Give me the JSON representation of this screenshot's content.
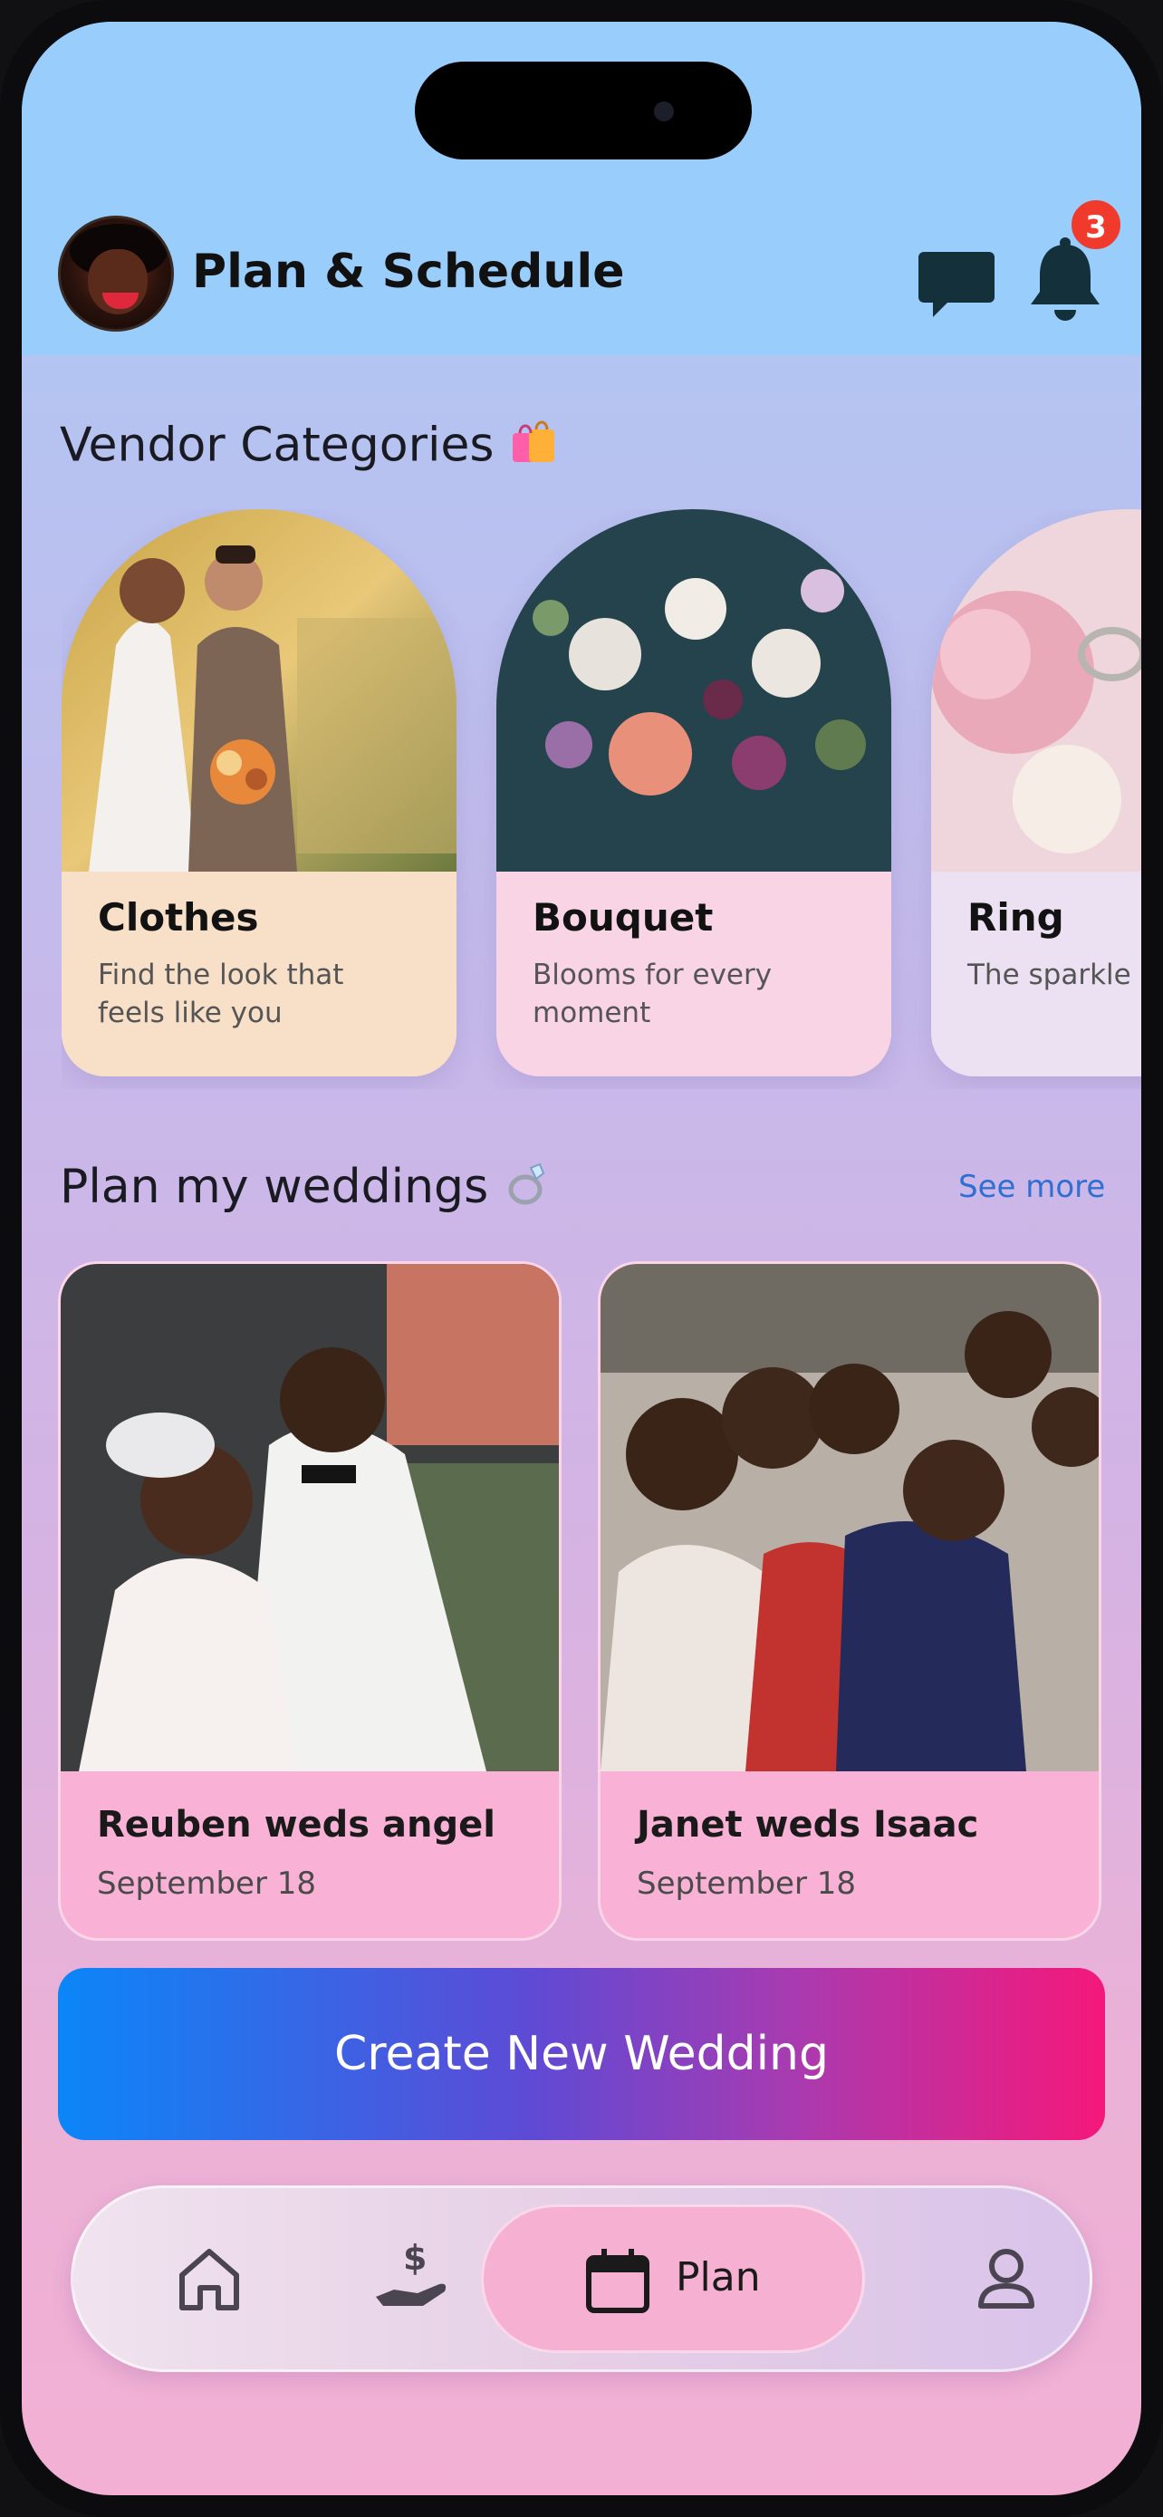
{
  "header": {
    "title": "Plan & Schedule",
    "notification_count": "3"
  },
  "vendor_section": {
    "title": "Vendor Categories",
    "emoji": "🛍️"
  },
  "vendors": [
    {
      "title": "Clothes",
      "subtitle": "Find the look that feels like you",
      "color": "#f7dfc8"
    },
    {
      "title": "Bouquet",
      "subtitle": "Blooms for every moment",
      "color": "#f8d4e4"
    },
    {
      "title": "Ring",
      "subtitle": "The sparkle",
      "color": "#ece1f2"
    }
  ],
  "weddings_section": {
    "title": "Plan my weddings",
    "emoji": "💍",
    "see_more": "See more"
  },
  "weddings": [
    {
      "title": "Reuben weds angel",
      "date": "September 18"
    },
    {
      "title": "Janet weds Isaac",
      "date": "September 18"
    }
  ],
  "cta": {
    "label": "Create New Wedding"
  },
  "nav": {
    "items": [
      {
        "icon": "home-icon"
      },
      {
        "icon": "money-hand-icon"
      },
      {
        "icon": "calendar-icon",
        "label": "Plan",
        "active": true
      },
      {
        "icon": "profile-icon"
      }
    ]
  }
}
